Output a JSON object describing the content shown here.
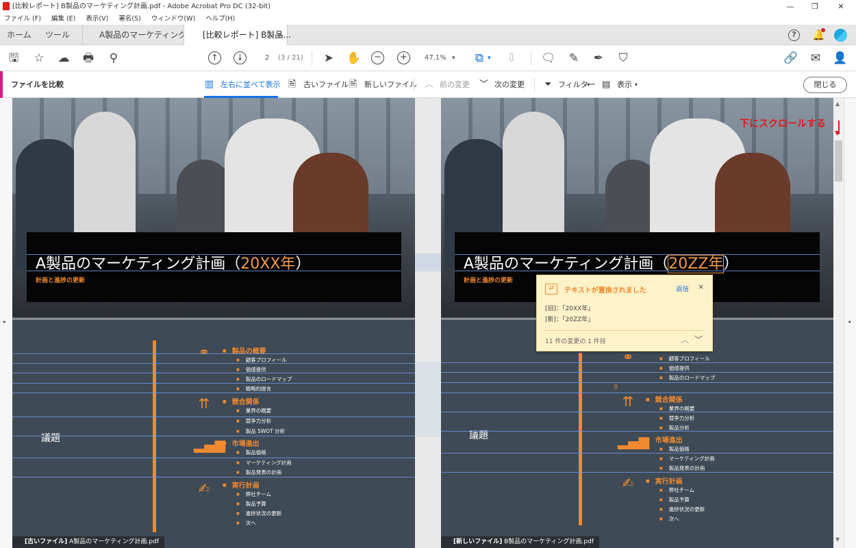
{
  "window": {
    "title": "[比較レポート] B製品のマーケティング計画.pdf - Adobe Acrobat Pro DC (32-bit)"
  },
  "menu": [
    "ファイル (F)",
    "編集 (E)",
    "表示(V)",
    "署名(S)",
    "ウィンドウ(W)",
    "ヘルプ(H)"
  ],
  "tabs": {
    "home": "ホーム",
    "tools": "ツール",
    "doc1": "A製品のマーケティング...",
    "doc2": "[比較レポート] B製品...",
    "close": "×"
  },
  "toolbar": {
    "page_current": "2",
    "page_info": "(3 / 21)",
    "zoom": "47.1%"
  },
  "compare_bar": {
    "title": "ファイルを比較",
    "side_by_side": "左右に並べて表示",
    "old_file": "古いファイル",
    "new_file": "新しいファイル",
    "prev_change": "前の変更",
    "next_change": "次の変更",
    "filter": "フィルター",
    "view": "表示",
    "close": "閉じる"
  },
  "left_page": {
    "title_main": "A製品のマーケティング計画（",
    "title_year": "20XX年",
    "title_end": "）",
    "subtitle": "計画と進捗の更新",
    "agenda": "議題",
    "caption_tag": "[古いファイル]",
    "caption_name": " A製品のマーケティング計画.pdf",
    "sections": [
      {
        "title": "製品の概要",
        "items": [
          "顧客プロフィール",
          "価値提供",
          "製品のロードマップ",
          "戦略的提言"
        ]
      },
      {
        "title": "競合関係",
        "items": [
          "業界の概要",
          "競争力分析",
          "製品 SWOT 分析"
        ]
      },
      {
        "title": "市場進出",
        "items": [
          "製品価格",
          "マーケティング計画",
          "製品発表の計画"
        ]
      },
      {
        "title": "実行計画",
        "items": [
          "弊社チーム",
          "製品予算",
          "進捗状況の更新",
          "次へ"
        ]
      }
    ]
  },
  "right_page": {
    "title_main": "A製品のマーケティング計画（",
    "title_year": "20ZZ年",
    "title_end": "）",
    "subtitle": "計画と進捗の更新",
    "agenda": "議題",
    "caption_tag": "[新しいファイル]",
    "caption_name": " B製品のマーケティング計画.pdf",
    "sections": [
      {
        "title": "",
        "items": [
          "顧客プロフィール",
          "価値提供",
          "製品のロードマップ"
        ]
      },
      {
        "title": "競合関係",
        "items": [
          "業界の概要",
          "競争力分析",
          "製品分析"
        ]
      },
      {
        "title": "市場進出",
        "items": [
          "製品価格",
          "マーケティング計画",
          "製品発表の計画"
        ]
      },
      {
        "title": "実行計画",
        "items": [
          "弊社チーム",
          "製品予算",
          "進捗状況の更新",
          "次へ"
        ]
      }
    ]
  },
  "popup": {
    "heading": "テキストが置換されました",
    "reply": "返信",
    "close": "×",
    "old_line": "[旧]：「20XX年」",
    "new_line": "[新]：「20ZZ年」",
    "footer": "11 件の変更の 1 件目"
  },
  "annotation": "下にスクロールする",
  "colors": {
    "accent": "#f08a30",
    "brand": "#d61a7f",
    "highlight": "#6c8fd9"
  }
}
